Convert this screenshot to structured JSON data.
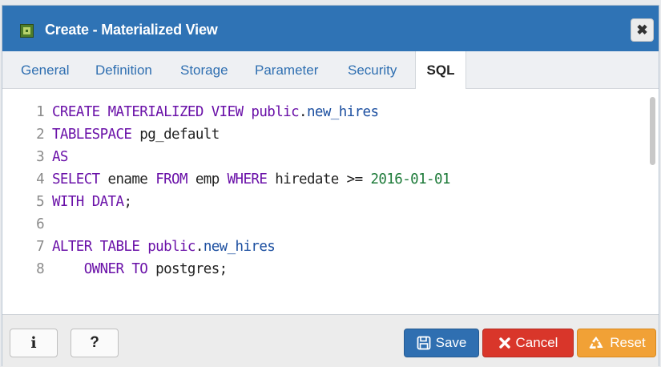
{
  "dialog": {
    "title": "Create - Materialized View",
    "title_icon": "materialized-view-icon",
    "close_icon": "close-icon",
    "close_glyph": "✖"
  },
  "tabs": [
    {
      "label": "General",
      "active": false
    },
    {
      "label": "Definition",
      "active": false
    },
    {
      "label": "Storage",
      "active": false
    },
    {
      "label": "Parameter",
      "active": false
    },
    {
      "label": "Security",
      "active": false
    },
    {
      "label": "SQL",
      "active": true
    }
  ],
  "editor": {
    "lines": [
      {
        "num": "1",
        "text": "CREATE MATERIALIZED VIEW public.new_hires"
      },
      {
        "num": "2",
        "text": "TABLESPACE pg_default"
      },
      {
        "num": "3",
        "text": "AS"
      },
      {
        "num": "4",
        "text": "SELECT ename FROM emp WHERE hiredate >= 2016-01-01"
      },
      {
        "num": "5",
        "text": "WITH DATA;"
      },
      {
        "num": "6",
        "text": ""
      },
      {
        "num": "7",
        "text": "ALTER TABLE public.new_hires"
      },
      {
        "num": "8",
        "text": "    OWNER TO postgres;"
      }
    ]
  },
  "footer": {
    "info_label": "i",
    "help_label": "?",
    "save_label": "Save",
    "cancel_label": "Cancel",
    "reset_label": "Reset"
  },
  "colors": {
    "titlebar": "#2f73b5",
    "keyword": "#6a11a8",
    "identifier": "#1c4fa0",
    "number": "#1e7b3a",
    "save": "#2f6fb1",
    "cancel": "#d9362a",
    "reset": "#f1a136"
  }
}
